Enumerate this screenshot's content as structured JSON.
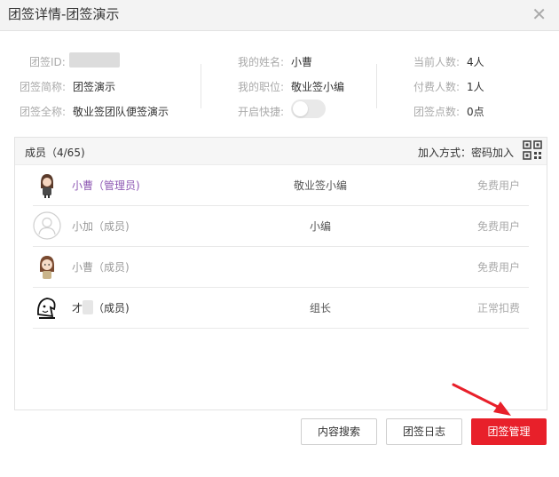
{
  "window": {
    "title": "团签详情-团签演示",
    "close_icon": "close-icon"
  },
  "info": {
    "group_id_label": "团签ID:",
    "short_name_label": "团签简称:",
    "short_name_value": "团签演示",
    "full_name_label": "团签全称:",
    "full_name_value": "敬业签团队便签演示",
    "my_name_label": "我的姓名:",
    "my_name_value": "小曹",
    "my_position_label": "我的职位:",
    "my_position_value": "敬业签小编",
    "shortcut_label": "开启快捷:",
    "shortcut_enabled": false,
    "current_count_label": "当前人数:",
    "current_count_value": "4人",
    "paid_count_label": "付费人数:",
    "paid_count_value": "1人",
    "points_label": "团签点数:",
    "points_value": "0点"
  },
  "members_panel": {
    "title": "成员（4/65)",
    "join_method": "加入方式：密码加入",
    "qr_icon": "qr-code-icon",
    "members": [
      {
        "name": "小曹（管理员)",
        "role": "敬业签小编",
        "status": "免费用户",
        "name_color": "#8e58b3"
      },
      {
        "name": "小加（成员)",
        "role": "小编",
        "status": "免费用户",
        "name_color": "#999999"
      },
      {
        "name": "小曹（成员)",
        "role": "",
        "status": "免费用户",
        "name_color": "#999999"
      },
      {
        "name_prefix": "才",
        "name_suffix": "（成员)",
        "role": "组长",
        "status": "正常扣费",
        "name_color": "#333333"
      }
    ]
  },
  "buttons": {
    "search": "内容搜索",
    "log": "团签日志",
    "manage": "团签管理"
  },
  "colors": {
    "accent_red": "#e8202a",
    "admin_purple": "#8e58b3"
  }
}
